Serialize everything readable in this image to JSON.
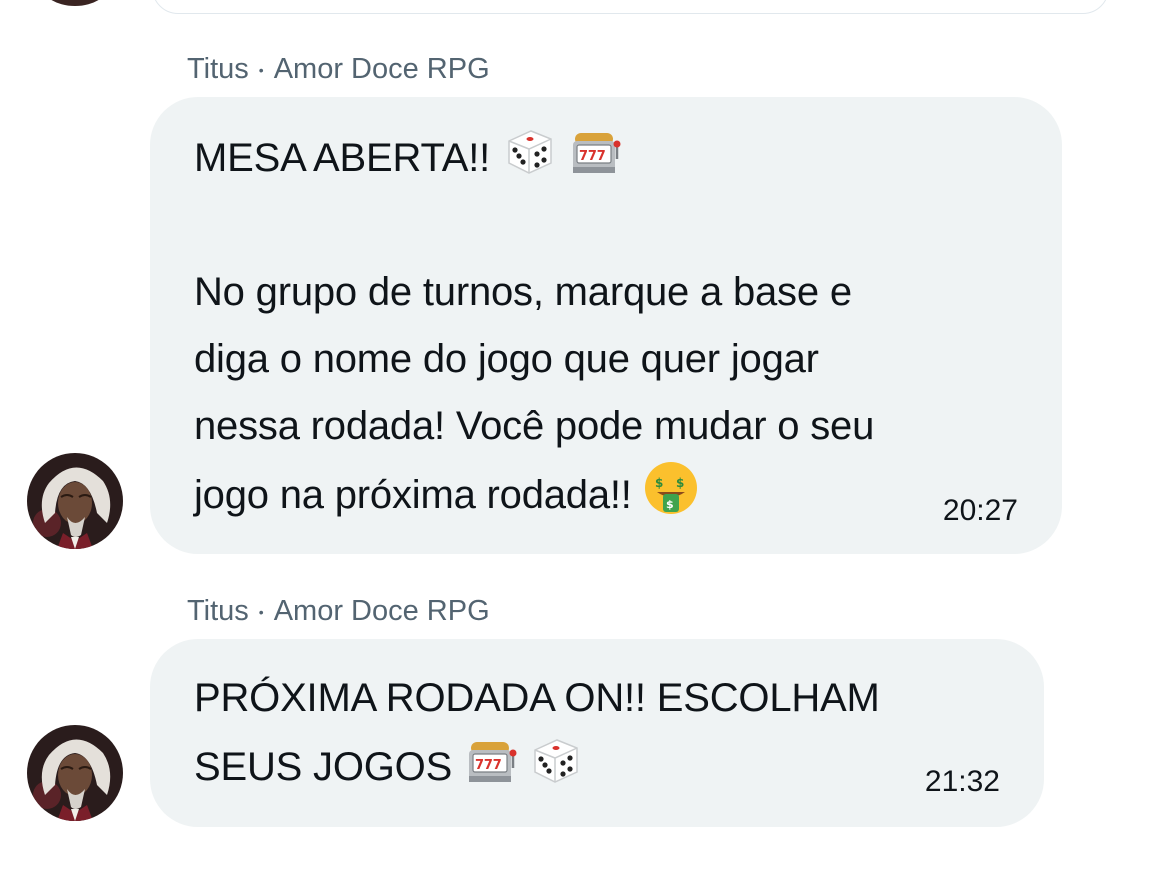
{
  "messages": [
    {
      "sender_name": "Titus",
      "sender_separator": "•",
      "sender_group": "Amor Doce RPG",
      "text_line_1": "MESA ABERTA!! ",
      "text_body": "No grupo de turnos, marque a base e\ndiga o nome do jogo que quer jogar\nnessa rodada! Você pode mudar o seu\njogo na próxima rodada!! ",
      "emojis_line_1": [
        "game-die-icon",
        "slot-machine-icon"
      ],
      "emoji_end": "money-mouth-face-icon",
      "time": "20:27"
    },
    {
      "sender_name": "Titus",
      "sender_separator": "•",
      "sender_group": "Amor Doce RPG",
      "text_line_1": "PRÓXIMA RODADA ON!! ESCOLHAM",
      "text_line_2": "SEUS JOGOS ",
      "emojis_line_2": [
        "slot-machine-icon",
        "game-die-icon"
      ],
      "time": "21:32"
    }
  ],
  "colors": {
    "bubble_bg": "#eff3f4",
    "meta_text": "#536471",
    "body_text": "#0f1419"
  }
}
